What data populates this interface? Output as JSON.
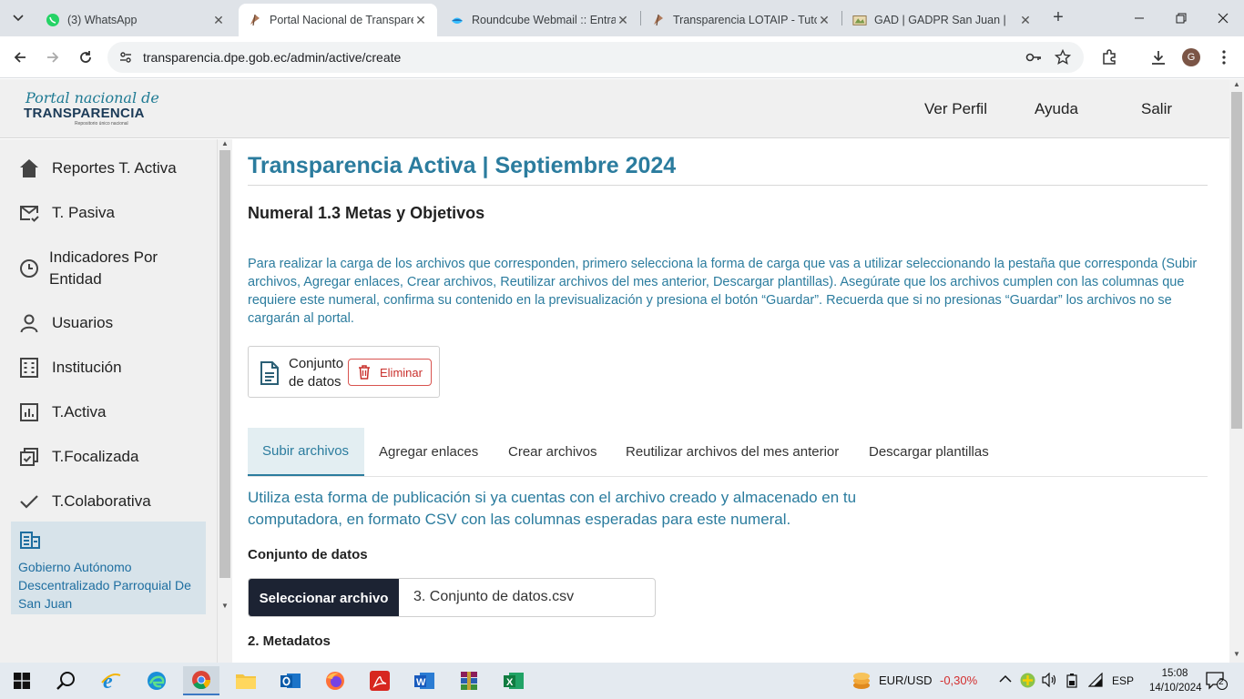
{
  "browser": {
    "tabs": [
      {
        "title": "(3) WhatsApp",
        "icon": "whatsapp-icon"
      },
      {
        "title": "Portal Nacional de Transparencia",
        "icon": "portal-icon"
      },
      {
        "title": "Roundcube Webmail :: Entrada",
        "icon": "roundcube-icon"
      },
      {
        "title": "Transparencia LOTAIP - Tutoriales",
        "icon": "portal-icon"
      },
      {
        "title": "GAD | GADPR San Juan |",
        "icon": "gad-icon"
      }
    ],
    "close_glyph": "✕",
    "new_tab_glyph": "+",
    "url": "transparencia.dpe.gob.ec/admin/active/create",
    "profile_initial": "G"
  },
  "header": {
    "logo_line1": "Portal nacional de",
    "logo_line2": "TRANSPARENCIA",
    "logo_line3": "Repositorio único nacional",
    "nav": [
      "Ver Perfil",
      "Ayuda",
      "Salir"
    ]
  },
  "sidebar": {
    "items": [
      {
        "label": "Reportes T. Activa",
        "icon": "home-icon"
      },
      {
        "label": "T. Pasiva",
        "icon": "mail-check-icon"
      },
      {
        "label": "Indicadores Por Entidad",
        "icon": "clock-icon"
      },
      {
        "label": "Usuarios",
        "icon": "user-icon"
      },
      {
        "label": "Institución",
        "icon": "building-icon"
      },
      {
        "label": "T.Activa",
        "icon": "chart-icon"
      },
      {
        "label": "T.Focalizada",
        "icon": "copy-check-icon"
      },
      {
        "label": "T.Colaborativa",
        "icon": "check-icon"
      }
    ],
    "entity": "Gobierno Autónomo Descentralizado Parroquial De San Juan"
  },
  "main": {
    "title": "Transparencia Activa | Septiembre 2024",
    "numeral": "Numeral 1.3 Metas y Objetivos",
    "instructions": "Para realizar la carga de los archivos que corresponden, primero selecciona la forma de carga que vas a utilizar seleccionando la pestaña que corresponda (Subir archivos, Agregar enlaces, Crear archivos, Reutilizar archivos del mes anterior, Descargar plantillas). Asegúrate que los archivos cumplen con las columnas que requiere este numeral, confirma su contenido en la previsualización y presiona el botón “Guardar”. Recuerda que si no presionas “Guardar” los archivos no se cargarán al portal.",
    "dataset_card": {
      "label": "Conjunto de datos",
      "delete_label": "Eliminar"
    },
    "tabs": [
      "Subir archivos",
      "Agregar enlaces",
      "Crear archivos",
      "Reutilizar archivos del mes anterior",
      "Descargar plantillas"
    ],
    "active_tab": "Subir archivos",
    "lead": "Utiliza esta forma de publicación si ya cuentas con el archivo creado y almacenado en tu computadora, en formato CSV con las columnas esperadas para este numeral.",
    "file_label": "Conjunto de datos",
    "file_button": "Seleccionar archivo",
    "file_name": "3. Conjunto de datos.csv",
    "metadata_label": "2. Metadatos"
  },
  "taskbar": {
    "fx_pair": "EUR/USD",
    "fx_change": "-0,30%",
    "lang": "ESP",
    "time": "15:08",
    "date": "14/10/2024",
    "notifications": "2"
  },
  "colors": {
    "accent": "#2b7c9e",
    "danger": "#c9302c",
    "dark_button": "#1c2333",
    "sidebar_bg": "#f0f0f0",
    "active_entity_bg": "#d7e3ea"
  }
}
